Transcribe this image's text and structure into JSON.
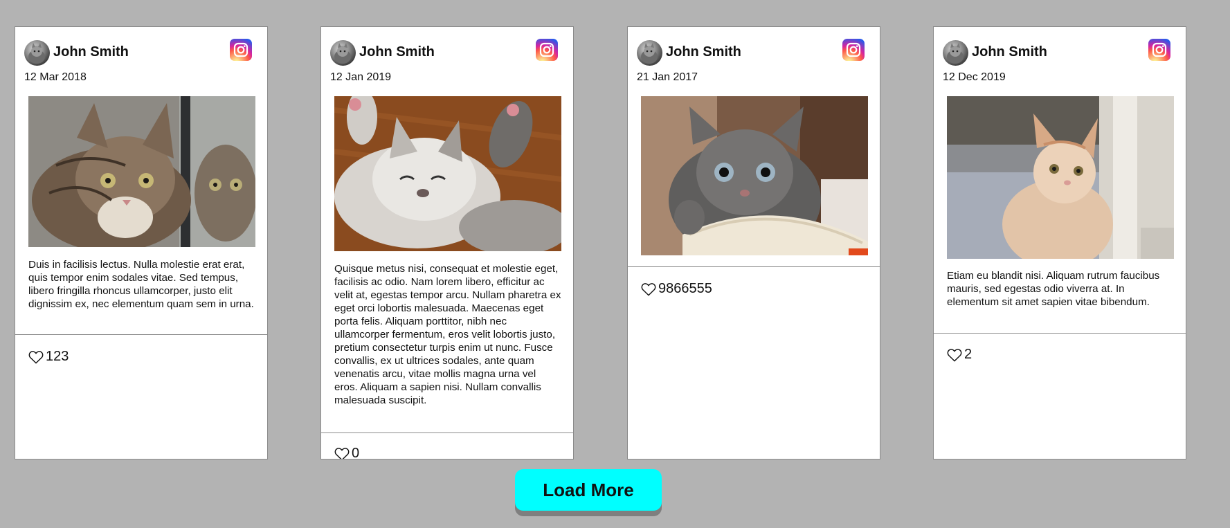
{
  "cards": [
    {
      "user_name": "John Smith",
      "date": "12 Mar 2018",
      "caption": "Duis in facilisis lectus. Nulla molestie erat erat, quis tempor enim sodales vitae. Sed tempus, libero fringilla rhoncus ullamcorper, justo elit dignissim ex, nec elementum quam sem in urna.",
      "likes": "123",
      "icons": {
        "avatar": "avatar-icon",
        "social": "instagram-icon",
        "like": "heart-icon"
      }
    },
    {
      "user_name": "John Smith",
      "date": "12 Jan 2019",
      "caption": "Quisque metus nisi, consequat et molestie eget, facilisis ac odio. Nam lorem libero, efficitur ac velit at, egestas tempor arcu. Nullam pharetra ex eget orci lobortis malesuada. Maecenas eget porta felis. Aliquam porttitor, nibh nec ullamcorper fermentum, eros velit lobortis justo, pretium consectetur turpis enim ut nunc. Fusce convallis, ex ut ultrices sodales, ante quam venenatis arcu, vitae mollis magna urna vel eros. Aliquam a sapien nisi. Nullam convallis malesuada suscipit.",
      "likes": "0",
      "icons": {
        "avatar": "avatar-icon",
        "social": "instagram-icon",
        "like": "heart-icon"
      }
    },
    {
      "user_name": "John Smith",
      "date": "21 Jan 2017",
      "caption": "",
      "likes": "9866555",
      "icons": {
        "avatar": "avatar-icon",
        "social": "instagram-icon",
        "like": "heart-icon"
      }
    },
    {
      "user_name": "John Smith",
      "date": "12 Dec 2019",
      "caption": "Etiam eu blandit nisi. Aliquam rutrum faucibus mauris, sed egestas odio viverra at. In elementum sit amet sapien vitae bibendum.",
      "likes": "2",
      "icons": {
        "avatar": "avatar-icon",
        "social": "instagram-icon",
        "like": "heart-icon"
      }
    }
  ],
  "load_more": {
    "label": "Load More"
  },
  "colors": {
    "background": "#b3b3b3",
    "card": "#ffffff",
    "button": "#00ffff"
  }
}
